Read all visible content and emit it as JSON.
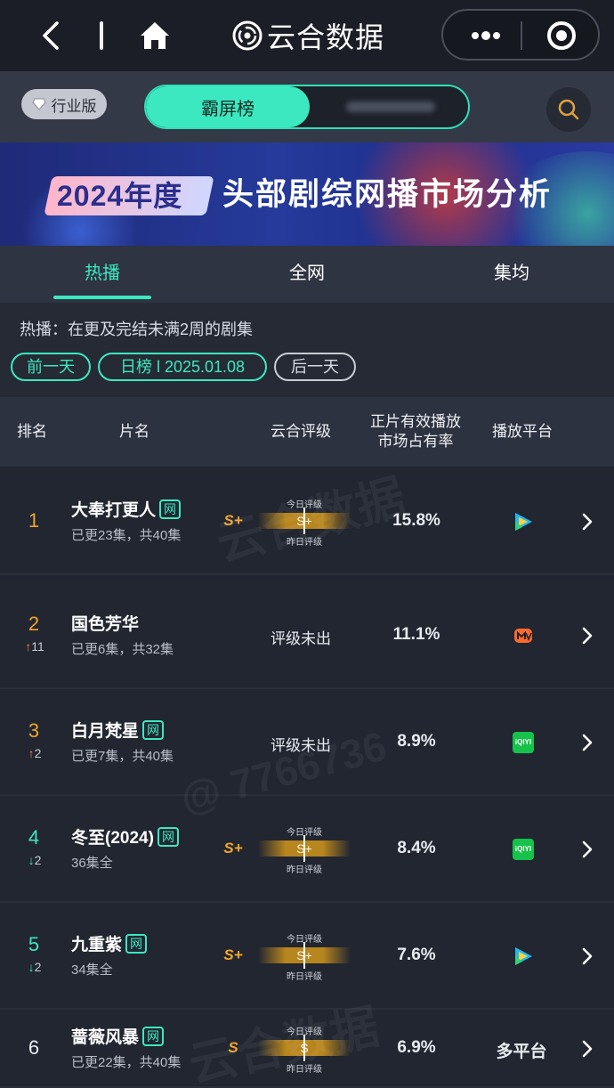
{
  "app": {
    "brand": "云合数据"
  },
  "header": {
    "edition_badge": "行业版",
    "segment_active": "霸屏榜"
  },
  "banner": {
    "year": "2024年度",
    "title": "头部剧综网播市场分析"
  },
  "tabs": [
    {
      "label": "热播",
      "active": true
    },
    {
      "label": "全网",
      "active": false
    },
    {
      "label": "集均",
      "active": false
    }
  ],
  "description": "热播：在更及完结未满2周的剧集",
  "date_nav": {
    "prev": "前一天",
    "current": "日榜 l 2025.01.08",
    "next": "后一天"
  },
  "table": {
    "columns": [
      "排名",
      "片名",
      "云合评级",
      "正片有效播放\n市场占有率",
      "播放平台"
    ],
    "grade_today_label": "今日评级",
    "grade_yesterday_label": "昨日评级",
    "net_badge": "网",
    "rows": [
      {
        "rank": "1",
        "rank_change": "",
        "change_dir": "",
        "title": "大奉打更人",
        "net": true,
        "episodes": "已更23集，共40集",
        "grade": "S+",
        "grade_bar": "S+",
        "grade_status": "",
        "share": "15.8%",
        "platform": "tencent-video-icon",
        "platform_text": ""
      },
      {
        "rank": "2",
        "rank_change": "11",
        "change_dir": "up",
        "title": "国色芳华",
        "net": false,
        "episodes": "已更6集，共32集",
        "grade": "",
        "grade_bar": "",
        "grade_status": "评级未出",
        "share": "11.1%",
        "platform": "mango-tv-icon",
        "platform_text": ""
      },
      {
        "rank": "3",
        "rank_change": "2",
        "change_dir": "up",
        "title": "白月梵星",
        "net": true,
        "episodes": "已更7集，共40集",
        "grade": "",
        "grade_bar": "",
        "grade_status": "评级未出",
        "share": "8.9%",
        "platform": "iqiyi-icon",
        "platform_text": ""
      },
      {
        "rank": "4",
        "rank_change": "2",
        "change_dir": "down",
        "title": "冬至(2024)",
        "net": true,
        "episodes": "36集全",
        "grade": "S+",
        "grade_bar": "S+",
        "grade_status": "",
        "share": "8.4%",
        "platform": "iqiyi-icon",
        "platform_text": ""
      },
      {
        "rank": "5",
        "rank_change": "2",
        "change_dir": "down",
        "title": "九重紫",
        "net": true,
        "episodes": "34集全",
        "grade": "S+",
        "grade_bar": "S+",
        "grade_status": "",
        "share": "7.6%",
        "platform": "tencent-video-icon",
        "platform_text": ""
      },
      {
        "rank": "6",
        "rank_change": "",
        "change_dir": "",
        "title": "蔷薇风暴",
        "net": true,
        "episodes": "已更22集，共40集",
        "grade": "S",
        "grade_bar": "S",
        "grade_status": "",
        "share": "6.9%",
        "platform": "",
        "platform_text": "多平台"
      }
    ]
  },
  "colors": {
    "accent": "#3ce8c0",
    "grade_gold": "#f0a52a",
    "rank_orange": "#f0a52a",
    "rank_green": "#3ce8c0",
    "up": "#ff7a45"
  }
}
